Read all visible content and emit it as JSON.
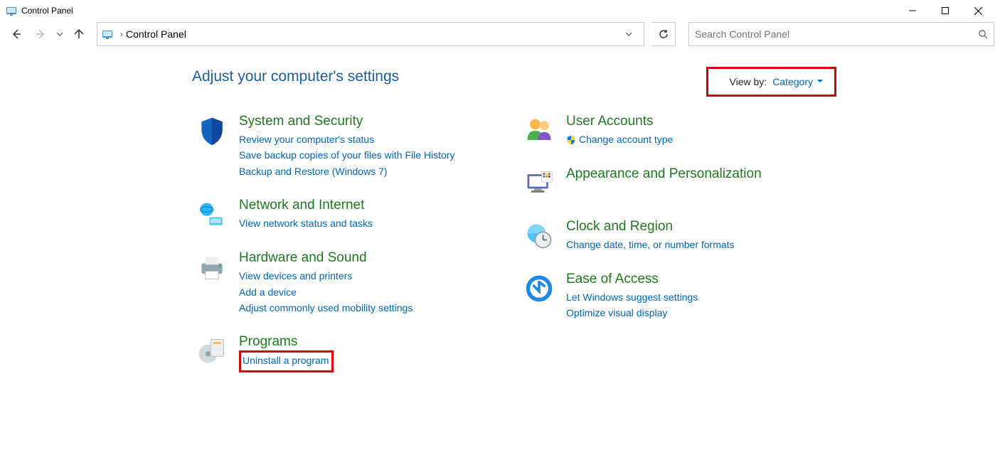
{
  "window": {
    "title": "Control Panel"
  },
  "addressbar": {
    "location": "Control Panel"
  },
  "search": {
    "placeholder": "Search Control Panel"
  },
  "main": {
    "heading": "Adjust your computer's settings",
    "viewby_label": "View by:",
    "viewby_value": "Category"
  },
  "left": {
    "system": {
      "title": "System and Security",
      "l1": "Review your computer's status",
      "l2": "Save backup copies of your files with File History",
      "l3": "Backup and Restore (Windows 7)"
    },
    "network": {
      "title": "Network and Internet",
      "l1": "View network status and tasks"
    },
    "hardware": {
      "title": "Hardware and Sound",
      "l1": "View devices and printers",
      "l2": "Add a device",
      "l3": "Adjust commonly used mobility settings"
    },
    "programs": {
      "title": "Programs",
      "l1": "Uninstall a program"
    }
  },
  "right": {
    "users": {
      "title": "User Accounts",
      "l1": "Change account type"
    },
    "appearance": {
      "title": "Appearance and Personalization"
    },
    "clock": {
      "title": "Clock and Region",
      "l1": "Change date, time, or number formats"
    },
    "ease": {
      "title": "Ease of Access",
      "l1": "Let Windows suggest settings",
      "l2": "Optimize visual display"
    }
  }
}
